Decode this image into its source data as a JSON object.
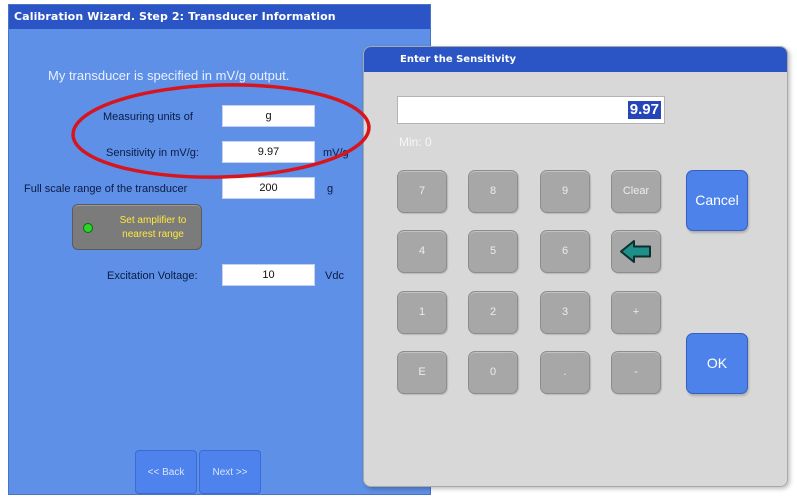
{
  "wizard": {
    "title": "Calibration Wizard.  Step 2: Transducer Information",
    "heading": "My transducer is specified in mV/g output.",
    "measuring_units": {
      "label": "Measuring units of",
      "value": "g"
    },
    "sensitivity": {
      "label": "Sensitivity in mV/g:",
      "value": "9.97",
      "unit": "mV/g"
    },
    "full_scale": {
      "label": "Full scale range of the transducer",
      "value": "200",
      "unit": "g"
    },
    "set_amplifier": {
      "line1": "Set amplifier to",
      "line2": "nearest range",
      "led_color": "#2ad42a"
    },
    "excitation": {
      "label": "Excitation Voltage:",
      "value": "10",
      "unit": "Vdc"
    },
    "back_label": "<< Back",
    "next_label": "Next >>"
  },
  "popup": {
    "title": "Enter the Sensitivity",
    "display_value": "9.97",
    "min_label": "Min: 0",
    "keys": {
      "k7": "7",
      "k8": "8",
      "k9": "9",
      "clear": "Clear",
      "k4": "4",
      "k5": "5",
      "k6": "6",
      "k1": "1",
      "k2": "2",
      "k3": "3",
      "plus": "+",
      "exp": "E",
      "k0": "0",
      "dot": ".",
      "minus": "-"
    },
    "cancel_label": "Cancel",
    "ok_label": "OK"
  },
  "colors": {
    "title_bar": "#2b55c4",
    "wizard_bg": "#5d90e6",
    "button_blue": "#4c82ea",
    "key_gray": "#a7a7a7",
    "highlight_ellipse": "#d8141c",
    "arrow_green": "#1f8f8a"
  },
  "icons": {
    "backspace": "backspace-arrow-icon",
    "led": "green-led-icon"
  }
}
